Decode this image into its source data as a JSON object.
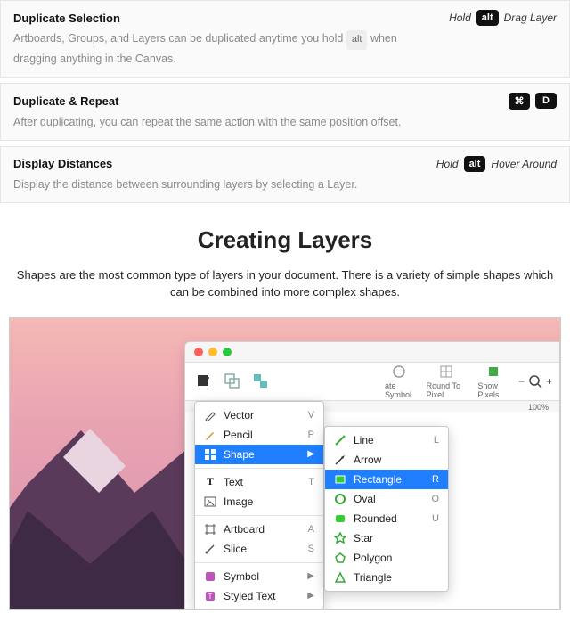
{
  "tips": [
    {
      "title": "Duplicate Selection",
      "desc_pre": "Artboards, Groups, and Layers can be duplicated anytime you hold ",
      "desc_key": "alt",
      "desc_post": " when dragging anything in the Canvas.",
      "shortcut_pre": "Hold",
      "shortcut_key": "alt",
      "shortcut_post": "Drag Layer"
    },
    {
      "title": "Duplicate & Repeat",
      "desc": "After duplicating, you can repeat the same action with the same position offset.",
      "keys": [
        "⌘",
        "D"
      ]
    },
    {
      "title": "Display Distances",
      "desc": "Display the distance between surrounding layers by selecting a Layer.",
      "shortcut_pre": "Hold",
      "shortcut_key": "alt",
      "shortcut_post": "Hover Around"
    }
  ],
  "section": {
    "title": "Creating Layers",
    "desc": "Shapes are the most common type of layers in your document. There is a variety of simple shapes which can be combined into more complex shapes."
  },
  "toolbar": {
    "late_symbol": "ate Symbol",
    "round": "Round To Pixel",
    "show": "Show Pixels",
    "zoom_minus": "−",
    "zoom_plus": "+",
    "zoom_val": "100%"
  },
  "menu": {
    "vector": "Vector",
    "vector_k": "V",
    "pencil": "Pencil",
    "pencil_k": "P",
    "shape": "Shape",
    "text": "Text",
    "text_k": "T",
    "image": "Image",
    "artboard": "Artboard",
    "artboard_k": "A",
    "slice": "Slice",
    "slice_k": "S",
    "symbol": "Symbol",
    "styled": "Styled Text"
  },
  "submenu": {
    "line": "Line",
    "line_k": "L",
    "arrow": "Arrow",
    "rectangle": "Rectangle",
    "rectangle_k": "R",
    "oval": "Oval",
    "oval_k": "O",
    "rounded": "Rounded",
    "rounded_k": "U",
    "star": "Star",
    "polygon": "Polygon",
    "triangle": "Triangle"
  }
}
